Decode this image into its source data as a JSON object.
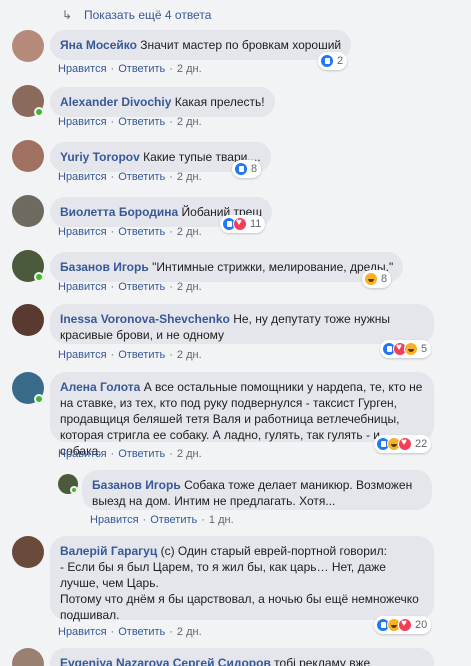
{
  "show_more": "Показать ещё 4 ответа",
  "actions": {
    "like": "Нравится",
    "reply": "Ответить",
    "sep": "·"
  },
  "comments": [
    {
      "name": "Яна Мосейко",
      "text": "Значит мастер по бровкам хороший",
      "time": "2 дн.",
      "reaction_count": "2",
      "reactions": [
        "like"
      ],
      "avatar_color": "#b58a7a",
      "online": false
    },
    {
      "name": "Alexander Divochiy",
      "text": "Какая прелесть!",
      "time": "2 дн.",
      "reaction_count": "",
      "reactions": [],
      "avatar_color": "#8a6a5a",
      "online": true
    },
    {
      "name": "Yuriy Toropov",
      "text": "Какие тупые твари....",
      "time": "2 дн.",
      "reaction_count": "8",
      "reactions": [
        "like"
      ],
      "avatar_color": "#a07060",
      "online": false
    },
    {
      "name": "Виолетта Бородина",
      "text": "Йобаний треш",
      "time": "2 дн.",
      "reaction_count": "11",
      "reactions": [
        "like",
        "love"
      ],
      "avatar_color": "#6e6a60",
      "online": false
    },
    {
      "name": "Базанов Игорь",
      "text": "\"Интимные стрижки, мелирование, дреды.\"",
      "time": "2 дн.",
      "reaction_count": "8",
      "reactions": [
        "haha"
      ],
      "avatar_color": "#4a5a3a",
      "online": true
    },
    {
      "name": "Inessa Voronova-Shevchenko",
      "text_line1": "Не, ну депутату тоже нужны",
      "text_line2": "красивые брови, и не одному",
      "time": "2 дн.",
      "reaction_count": "5",
      "reactions": [
        "like",
        "love",
        "haha"
      ],
      "avatar_color": "#5a3a30",
      "online": false
    },
    {
      "name": "Алена Голота",
      "text_line1": "А все остальные помощники у нардепа, те, кто не",
      "text_line2": "на ставке, из тех, кто под руку подвернулся - таксист Гурген,",
      "text_line3": "продавщиця беляшей тетя Валя и работница ветлечебницы,",
      "text_line4": "которая стригла ее собаку. А ладно, гулять, так гулять - и собака.",
      "time": "2 дн.",
      "reaction_count": "22",
      "reactions": [
        "like",
        "haha",
        "love"
      ],
      "avatar_color": "#3a6a8a",
      "online": true
    }
  ],
  "reply": {
    "name": "Базанов Игорь",
    "text_line1": "Собака тоже делает маникюр. Возможен",
    "text_line2": "выезд на дом. Интим не предлагать. Хотя...",
    "time": "1 дн.",
    "avatar_color": "#4a5a3a"
  },
  "last": {
    "name": "Валерій Гарагуц",
    "text_line1": "(с) Один старый еврей-портной говорил:",
    "text_line2": "- Если бы я был Царем, то я жил бы, как царь… Нет, даже",
    "text_line3": "лучше, чем Царь.",
    "text_line4": "Потому что днём я бы царствовал, а ночью бы ещё немножечко",
    "text_line5": "подшивал.",
    "time": "2 дн.",
    "reaction_count": "20",
    "reactions": [
      "like",
      "haha",
      "love"
    ],
    "avatar_color": "#6a4a3a"
  },
  "peek": {
    "name1": "Evgeniya Nazarova",
    "name2": "Сергей Сидоров",
    "text": "тобі рекламу вже"
  }
}
